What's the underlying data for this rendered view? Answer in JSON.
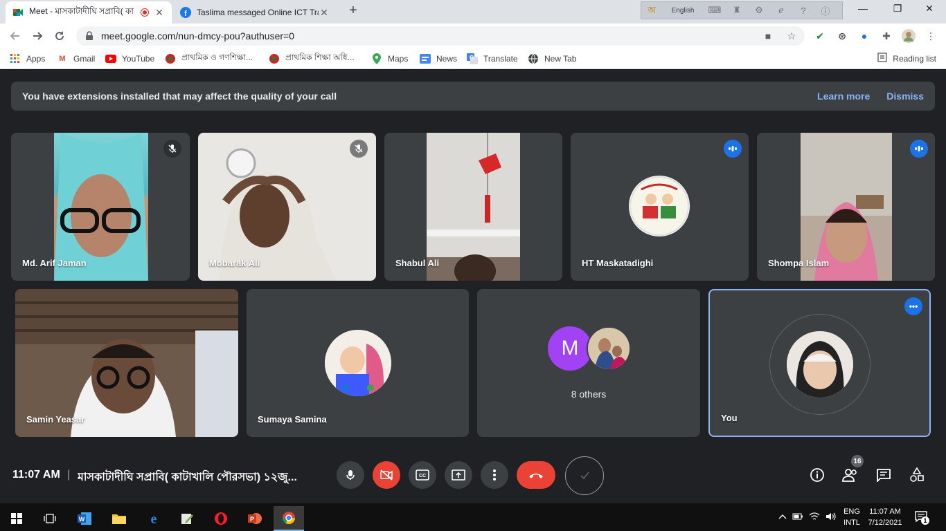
{
  "browser": {
    "tabs": [
      {
        "title": "Meet - মাসকাটাদীঘি সপ্রাবি( কা",
        "active": true
      },
      {
        "title": "Taslima messaged Online ICT Trai",
        "active": false
      }
    ],
    "language_bar": {
      "language": "English"
    },
    "url": "meet.google.com/nun-dmcy-pou?authuser=0",
    "bookmarks": [
      {
        "label": "Apps",
        "icon": "apps-grid-icon"
      },
      {
        "label": "Gmail",
        "icon": "gmail-icon"
      },
      {
        "label": "YouTube",
        "icon": "youtube-icon"
      },
      {
        "label": "প্রাথমিক ও গণশিক্ষা...",
        "icon": "bd-gov-icon"
      },
      {
        "label": "প্রাথমিক শিক্ষা অধি...",
        "icon": "bd-gov-icon"
      },
      {
        "label": "Maps",
        "icon": "maps-pin-icon"
      },
      {
        "label": "News",
        "icon": "news-icon"
      },
      {
        "label": "Translate",
        "icon": "translate-icon"
      },
      {
        "label": "New Tab",
        "icon": "globe-icon"
      }
    ],
    "reading_list": "Reading list"
  },
  "banner": {
    "message": "You have extensions installed that may affect the quality of your call",
    "learn_more": "Learn more",
    "dismiss": "Dismiss"
  },
  "participants": [
    {
      "name": "Md. Arif Jaman",
      "status": "muted"
    },
    {
      "name": "Mobarak Ali",
      "status": "muted"
    },
    {
      "name": "Shabul Ali",
      "status": "none"
    },
    {
      "name": "HT Maskatadighi",
      "status": "speaking"
    },
    {
      "name": "Shompa Islam",
      "status": "speaking"
    },
    {
      "name": "Samin Yeasar",
      "status": "none"
    },
    {
      "name": "Sumaya Samina",
      "status": "none"
    },
    {
      "name": "8 others",
      "status": "none",
      "avatar_letter": "M"
    },
    {
      "name": "You",
      "status": "self"
    }
  ],
  "bottom_bar": {
    "time": "11:07 AM",
    "separator": "|",
    "meeting_title": "মাসকাটাদীঘি সপ্রাবি( কাটাখালি পৌরসভা) ১২জু...",
    "participant_count": "16"
  },
  "taskbar": {
    "input_lang": "ENG",
    "input_layout": "INTL",
    "clock_time": "11:07 AM",
    "clock_date": "7/12/2021",
    "notification_count": "1"
  },
  "colors": {
    "meet_bg": "#202124",
    "tile_bg": "#3c4043",
    "accent_blue": "#1a73e8",
    "link_blue": "#8ab4f8",
    "danger_red": "#ea4335"
  }
}
